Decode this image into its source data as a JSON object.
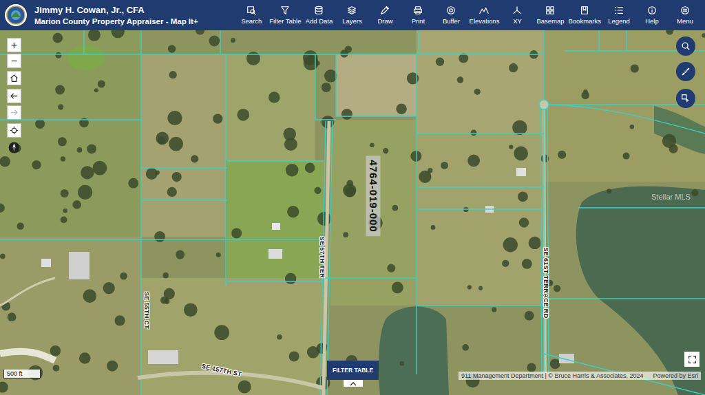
{
  "header": {
    "title": "Jimmy H. Cowan, Jr., CFA",
    "subtitle": "Marion County Property Appraiser - Map It+"
  },
  "toolbar": [
    {
      "label": "Search"
    },
    {
      "label": "Filter Table"
    },
    {
      "label": "Add Data"
    },
    {
      "label": "Layers"
    },
    {
      "label": "Draw"
    },
    {
      "label": "Print"
    },
    {
      "label": "Buffer"
    },
    {
      "label": "Elevations"
    },
    {
      "label": "XY"
    },
    {
      "label": "Basemap"
    },
    {
      "label": "Bookmarks"
    },
    {
      "label": "Legend"
    },
    {
      "label": "Help"
    },
    {
      "label": "Menu"
    }
  ],
  "map": {
    "zoom_in": "+",
    "zoom_out": "−",
    "history": [
      {
        "disabled": false
      },
      {
        "disabled": true
      }
    ],
    "parcel_label": "4764-019-000",
    "roads": [
      {
        "name": "SE 57TH TER"
      },
      {
        "name": "SE 61ST TERRACE RD"
      },
      {
        "name": "SE 55TH CT"
      },
      {
        "name": "SE 157TH ST"
      }
    ],
    "watermark": "Stellar MLS",
    "scale": "500 ft",
    "attribution": "911 Management Department | © Bruce Harris & Associates, 2024",
    "powered_by": "Powered by Esri"
  },
  "filter_table": {
    "label": "FILTER TABLE"
  }
}
